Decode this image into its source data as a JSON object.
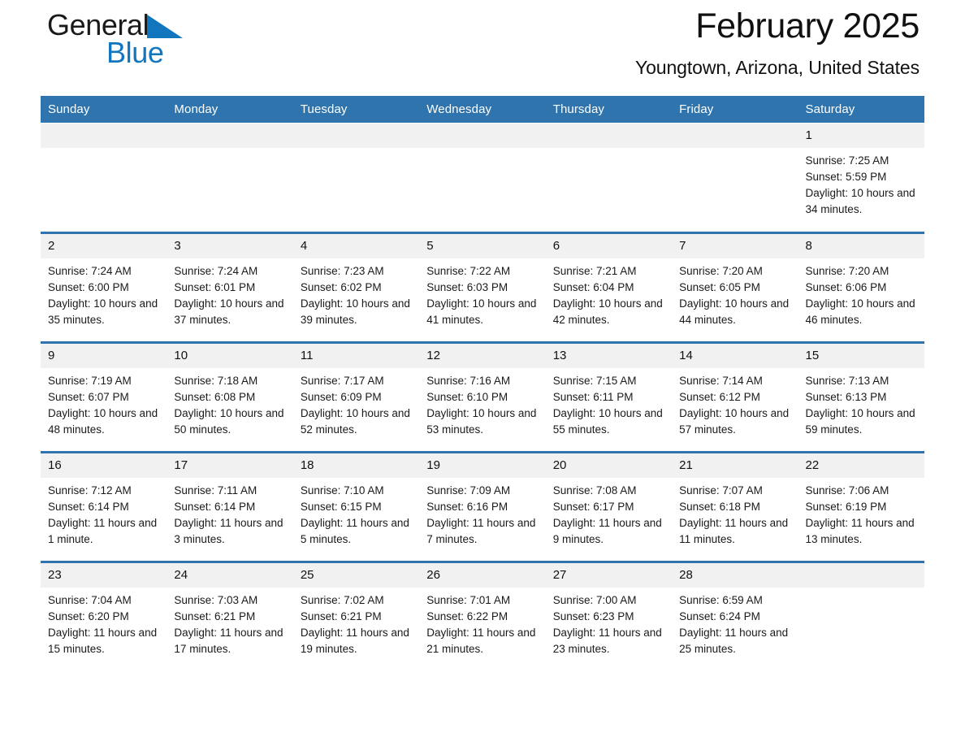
{
  "brand": {
    "name_part1": "General",
    "name_part2": "Blue",
    "triangle_color": "#1276bf"
  },
  "header": {
    "title": "February 2025",
    "location": "Youngtown, Arizona, United States"
  },
  "theme": {
    "header_blue": "#2f74ad",
    "daynum_bg": "#f1f1f1",
    "accent_blue": "#1276bf"
  },
  "weekdays": [
    "Sunday",
    "Monday",
    "Tuesday",
    "Wednesday",
    "Thursday",
    "Friday",
    "Saturday"
  ],
  "calendar": {
    "month": "February",
    "year": 2025,
    "weeks": [
      [
        {
          "day": "",
          "empty": true
        },
        {
          "day": "",
          "empty": true
        },
        {
          "day": "",
          "empty": true
        },
        {
          "day": "",
          "empty": true
        },
        {
          "day": "",
          "empty": true
        },
        {
          "day": "",
          "empty": true
        },
        {
          "day": "1",
          "sunrise": "Sunrise: 7:25 AM",
          "sunset": "Sunset: 5:59 PM",
          "daylight": "Daylight: 10 hours and 34 minutes."
        }
      ],
      [
        {
          "day": "2",
          "sunrise": "Sunrise: 7:24 AM",
          "sunset": "Sunset: 6:00 PM",
          "daylight": "Daylight: 10 hours and 35 minutes."
        },
        {
          "day": "3",
          "sunrise": "Sunrise: 7:24 AM",
          "sunset": "Sunset: 6:01 PM",
          "daylight": "Daylight: 10 hours and 37 minutes."
        },
        {
          "day": "4",
          "sunrise": "Sunrise: 7:23 AM",
          "sunset": "Sunset: 6:02 PM",
          "daylight": "Daylight: 10 hours and 39 minutes."
        },
        {
          "day": "5",
          "sunrise": "Sunrise: 7:22 AM",
          "sunset": "Sunset: 6:03 PM",
          "daylight": "Daylight: 10 hours and 41 minutes."
        },
        {
          "day": "6",
          "sunrise": "Sunrise: 7:21 AM",
          "sunset": "Sunset: 6:04 PM",
          "daylight": "Daylight: 10 hours and 42 minutes."
        },
        {
          "day": "7",
          "sunrise": "Sunrise: 7:20 AM",
          "sunset": "Sunset: 6:05 PM",
          "daylight": "Daylight: 10 hours and 44 minutes."
        },
        {
          "day": "8",
          "sunrise": "Sunrise: 7:20 AM",
          "sunset": "Sunset: 6:06 PM",
          "daylight": "Daylight: 10 hours and 46 minutes."
        }
      ],
      [
        {
          "day": "9",
          "sunrise": "Sunrise: 7:19 AM",
          "sunset": "Sunset: 6:07 PM",
          "daylight": "Daylight: 10 hours and 48 minutes."
        },
        {
          "day": "10",
          "sunrise": "Sunrise: 7:18 AM",
          "sunset": "Sunset: 6:08 PM",
          "daylight": "Daylight: 10 hours and 50 minutes."
        },
        {
          "day": "11",
          "sunrise": "Sunrise: 7:17 AM",
          "sunset": "Sunset: 6:09 PM",
          "daylight": "Daylight: 10 hours and 52 minutes."
        },
        {
          "day": "12",
          "sunrise": "Sunrise: 7:16 AM",
          "sunset": "Sunset: 6:10 PM",
          "daylight": "Daylight: 10 hours and 53 minutes."
        },
        {
          "day": "13",
          "sunrise": "Sunrise: 7:15 AM",
          "sunset": "Sunset: 6:11 PM",
          "daylight": "Daylight: 10 hours and 55 minutes."
        },
        {
          "day": "14",
          "sunrise": "Sunrise: 7:14 AM",
          "sunset": "Sunset: 6:12 PM",
          "daylight": "Daylight: 10 hours and 57 minutes."
        },
        {
          "day": "15",
          "sunrise": "Sunrise: 7:13 AM",
          "sunset": "Sunset: 6:13 PM",
          "daylight": "Daylight: 10 hours and 59 minutes."
        }
      ],
      [
        {
          "day": "16",
          "sunrise": "Sunrise: 7:12 AM",
          "sunset": "Sunset: 6:14 PM",
          "daylight": "Daylight: 11 hours and 1 minute."
        },
        {
          "day": "17",
          "sunrise": "Sunrise: 7:11 AM",
          "sunset": "Sunset: 6:14 PM",
          "daylight": "Daylight: 11 hours and 3 minutes."
        },
        {
          "day": "18",
          "sunrise": "Sunrise: 7:10 AM",
          "sunset": "Sunset: 6:15 PM",
          "daylight": "Daylight: 11 hours and 5 minutes."
        },
        {
          "day": "19",
          "sunrise": "Sunrise: 7:09 AM",
          "sunset": "Sunset: 6:16 PM",
          "daylight": "Daylight: 11 hours and 7 minutes."
        },
        {
          "day": "20",
          "sunrise": "Sunrise: 7:08 AM",
          "sunset": "Sunset: 6:17 PM",
          "daylight": "Daylight: 11 hours and 9 minutes."
        },
        {
          "day": "21",
          "sunrise": "Sunrise: 7:07 AM",
          "sunset": "Sunset: 6:18 PM",
          "daylight": "Daylight: 11 hours and 11 minutes."
        },
        {
          "day": "22",
          "sunrise": "Sunrise: 7:06 AM",
          "sunset": "Sunset: 6:19 PM",
          "daylight": "Daylight: 11 hours and 13 minutes."
        }
      ],
      [
        {
          "day": "23",
          "sunrise": "Sunrise: 7:04 AM",
          "sunset": "Sunset: 6:20 PM",
          "daylight": "Daylight: 11 hours and 15 minutes."
        },
        {
          "day": "24",
          "sunrise": "Sunrise: 7:03 AM",
          "sunset": "Sunset: 6:21 PM",
          "daylight": "Daylight: 11 hours and 17 minutes."
        },
        {
          "day": "25",
          "sunrise": "Sunrise: 7:02 AM",
          "sunset": "Sunset: 6:21 PM",
          "daylight": "Daylight: 11 hours and 19 minutes."
        },
        {
          "day": "26",
          "sunrise": "Sunrise: 7:01 AM",
          "sunset": "Sunset: 6:22 PM",
          "daylight": "Daylight: 11 hours and 21 minutes."
        },
        {
          "day": "27",
          "sunrise": "Sunrise: 7:00 AM",
          "sunset": "Sunset: 6:23 PM",
          "daylight": "Daylight: 11 hours and 23 minutes."
        },
        {
          "day": "28",
          "sunrise": "Sunrise: 6:59 AM",
          "sunset": "Sunset: 6:24 PM",
          "daylight": "Daylight: 11 hours and 25 minutes."
        },
        {
          "day": "",
          "empty": true
        }
      ]
    ]
  }
}
